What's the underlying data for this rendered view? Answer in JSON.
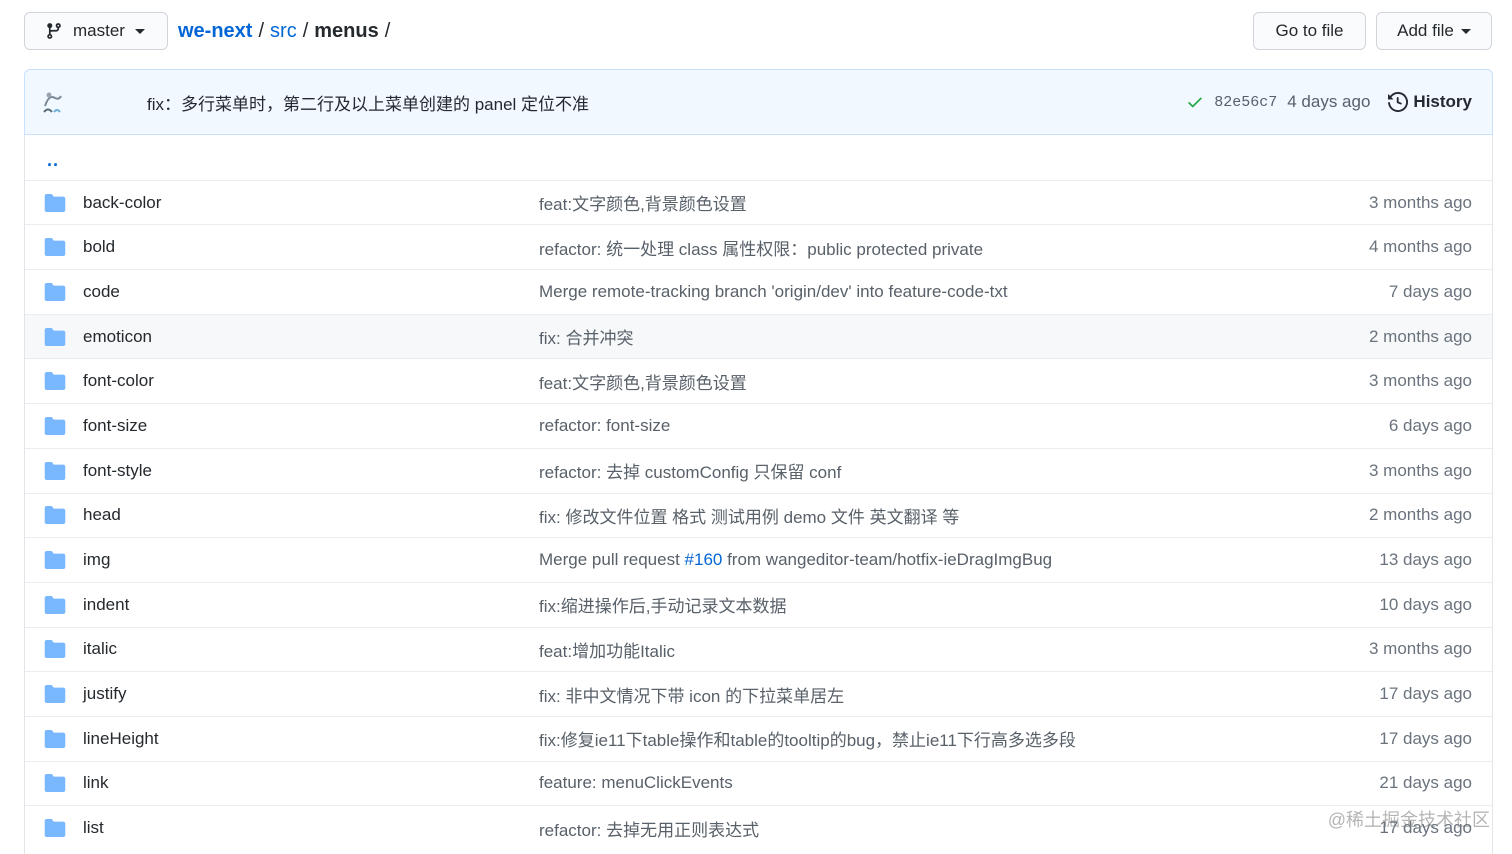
{
  "branch": {
    "name": "master"
  },
  "breadcrumb": {
    "repo": "we-next",
    "folder": "src",
    "current": "menus",
    "sep": "/",
    "trailing": "/"
  },
  "actions": {
    "go_to_file": "Go to file",
    "add_file": "Add file"
  },
  "latest_commit": {
    "message": "fix：多行菜单时，第二行及以上菜单创建的 panel 定位不准",
    "sha": "82e56c7",
    "time": "4 days ago",
    "history_label": "History"
  },
  "updir": "..",
  "files": [
    {
      "name": "back-color",
      "msg": "feat:文字颜色,背景颜色设置",
      "age": "3 months ago"
    },
    {
      "name": "bold",
      "msg": "refactor: 统一处理 class 属性权限：public protected private",
      "age": "4 months ago"
    },
    {
      "name": "code",
      "msg": "Merge remote-tracking branch 'origin/dev' into feature-code-txt",
      "age": "7 days ago"
    },
    {
      "name": "emoticon",
      "msg": "fix: 合并冲突",
      "age": "2 months ago"
    },
    {
      "name": "font-color",
      "msg": "feat:文字颜色,背景颜色设置",
      "age": "3 months ago"
    },
    {
      "name": "font-size",
      "msg": "refactor: font-size",
      "age": "6 days ago"
    },
    {
      "name": "font-style",
      "msg": "refactor: 去掉 customConfig 只保留 conf",
      "age": "3 months ago"
    },
    {
      "name": "head",
      "msg": "fix: 修改文件位置 格式 测试用例 demo 文件 英文翻译 等",
      "age": "2 months ago"
    },
    {
      "name": "img",
      "msg_pre": "Merge pull request ",
      "msg_issue": "#160",
      "msg_post": " from wangeditor-team/hotfix-ieDragImgBug",
      "age": "13 days ago"
    },
    {
      "name": "indent",
      "msg": "fix:缩进操作后,手动记录文本数据",
      "age": "10 days ago"
    },
    {
      "name": "italic",
      "msg": "feat:增加功能Italic",
      "age": "3 months ago"
    },
    {
      "name": "justify",
      "msg": "fix: 非中文情况下带 icon 的下拉菜单居左",
      "age": "17 days ago"
    },
    {
      "name": "lineHeight",
      "msg": "fix:修复ie11下table操作和table的tooltip的bug，禁止ie11下行高多选多段",
      "age": "17 days ago"
    },
    {
      "name": "link",
      "msg": "feature: menuClickEvents",
      "age": "21 days ago"
    },
    {
      "name": "list",
      "msg": "refactor: 去掉无用正则表达式",
      "age": "17 days ago"
    }
  ],
  "watermark": "@稀土掘金技术社区",
  "colors": {
    "link": "#0366d6",
    "folder": "#79b8ff",
    "check": "#28a745",
    "commit_bg": "#f1f8ff"
  }
}
